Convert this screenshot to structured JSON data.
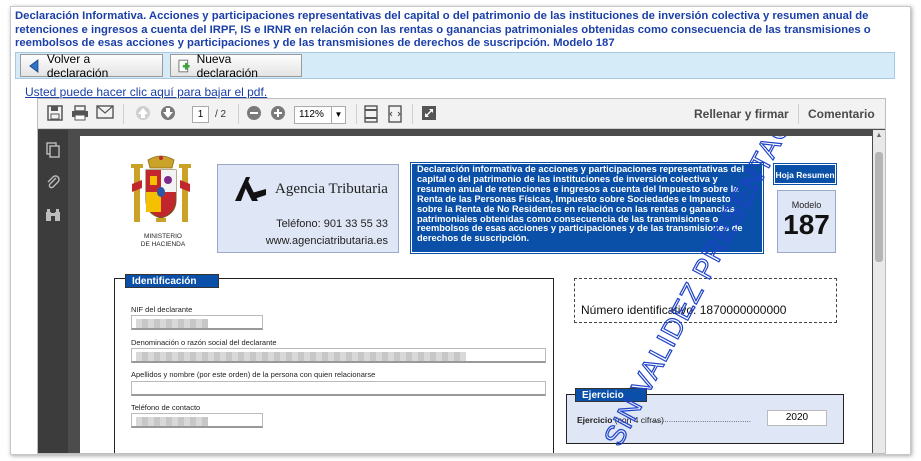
{
  "heading": "Declaración Informativa. Acciones y participaciones representativas del capital o del patrimonio de las instituciones de inversión colectiva y resumen anual de retenciones e ingresos a cuenta del IRPF, IS e IRNR en relación con las rentas o ganancias patrimoniales obtenidas como consecuencia de las transmisiones o reembolsos de esas acciones y participaciones y de las transmisiones de derechos de suscripción. Modelo 187",
  "toolbar": {
    "back_label": "Volver a declaración",
    "new_label": "Nueva declaración"
  },
  "download_link": "Usted puede hacer clic aquí para bajar el pdf.",
  "viewer": {
    "page_current": "1",
    "page_total": "/ 2",
    "zoom": "112%",
    "fill_sign": "Rellenar y firmar",
    "comment": "Comentario"
  },
  "doc": {
    "ministry": "MINISTERIO\nDE HACIENDA",
    "agency_name": "Agencia Tributaria",
    "agency_phone": "Teléfono: 901 33 55 33",
    "agency_web": "www.agenciatributaria.es",
    "description": "Declaración informativa de acciones y participaciones representativas del capital o del patrimonio de las instituciones de inversión colectiva y resumen anual de retenciones e ingresos a cuenta del Impuesto sobre la Renta de las Personas Físicas, Impuesto sobre Sociedades e Impuesto sobre la Renta de No Residentes en relación con las rentas o ganancias patrimoniales obtenidas como consecuencia de las transmisiones o reembolsos de esas acciones y participaciones y de las transmisiones de derechos de suscripción.",
    "hoja_resumen": "Hoja Resumen",
    "modelo_label": "Modelo",
    "modelo_number": "187",
    "identificacion": {
      "title": "Identificación",
      "nif_label": "NIF del declarante",
      "denominacion_label": "Denominación o razón social del declarante",
      "persona_label": "Apellidos y nombre (por este orden) de la persona con quien relacionarse",
      "telefono_label": "Teléfono de contacto"
    },
    "numero_identificativo": "Número identificativo:  1870000000000",
    "ejercicio": {
      "title": "Ejercicio",
      "label": "Ejercicio",
      "sub": " (con 4 cifras)",
      "dots": "...................................................................",
      "value": "2020"
    },
    "watermark": "SIN VALIDEZ PRESENTACIÓN"
  },
  "colors": {
    "heading": "#1a3fa8",
    "toolbar_bg": "#d6ebf8",
    "aeat_blue": "#0a4fa8",
    "form_bg": "#dfe6f5",
    "viewer_bg": "#4c4c4c"
  }
}
